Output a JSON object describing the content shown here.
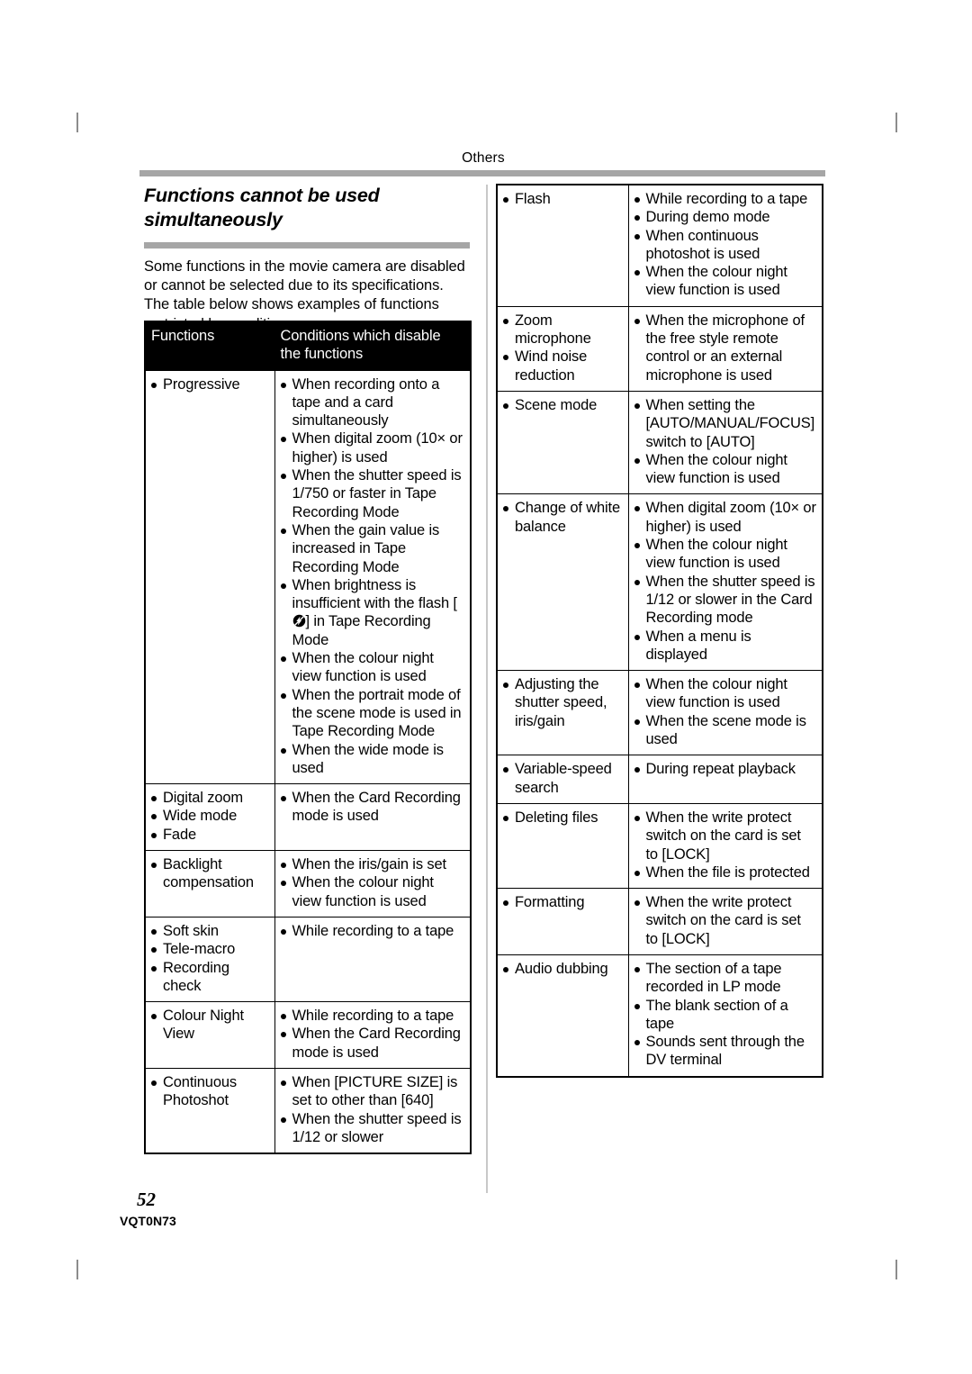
{
  "running_head": "Others",
  "page": {
    "title": "Functions cannot be used simultaneously",
    "intro": "Some functions in the movie camera are disabled or cannot be selected due to its specifications. The table below shows examples of functions restricted by conditions.",
    "folio": "52",
    "doc_code": "VQT0N73"
  },
  "table": {
    "headers": {
      "functions": "Functions",
      "conditions": "Conditions which disable the functions"
    },
    "left_rows": [
      {
        "functions": [
          "Progressive"
        ],
        "conditions": [
          "When recording onto a tape and a card simultaneously",
          "When digital zoom (10× or higher) is used",
          "When the shutter speed is 1/750 or faster in Tape Recording Mode",
          "When the gain value is increased in Tape Recording Mode",
          "When brightness is insufficient with the flash [FLASH_ICON] in Tape Recording Mode",
          "When the colour night view function is used",
          "When the portrait mode of the scene mode is used in Tape Recording Mode",
          "When the wide mode is used"
        ]
      },
      {
        "functions": [
          "Digital zoom",
          "Wide mode",
          "Fade"
        ],
        "conditions": [
          "When the Card Recording mode is used"
        ]
      },
      {
        "functions": [
          "Backlight compensation"
        ],
        "conditions": [
          "When the iris/gain is set",
          "When the colour night view function is used"
        ]
      },
      {
        "functions": [
          "Soft skin",
          "Tele-macro",
          "Recording check"
        ],
        "conditions": [
          "While recording to a tape"
        ]
      },
      {
        "functions": [
          "Colour Night View"
        ],
        "conditions": [
          "While recording to a tape",
          "When the Card Recording mode is used"
        ]
      },
      {
        "functions": [
          "Continuous Photoshot"
        ],
        "conditions": [
          "When [PICTURE SIZE] is set to other than [640]",
          "When the shutter speed is 1/12 or slower"
        ]
      }
    ],
    "right_rows": [
      {
        "functions": [
          "Flash"
        ],
        "conditions": [
          "While recording to a tape",
          "During demo mode",
          "When continuous photoshot is used",
          "When the colour night view function is used"
        ]
      },
      {
        "functions": [
          "Zoom microphone",
          "Wind noise reduction"
        ],
        "conditions": [
          "When the microphone of the free style remote control or an external microphone is used"
        ]
      },
      {
        "functions": [
          "Scene mode"
        ],
        "conditions": [
          "When setting the [AUTO/MANUAL/FOCUS] switch to [AUTO]",
          "When the colour night view function is used"
        ]
      },
      {
        "functions": [
          "Change of white balance"
        ],
        "conditions": [
          "When digital zoom (10× or higher) is used",
          "When the colour night view function is used",
          "When the shutter speed is 1/12 or slower in the Card Recording mode",
          "When a menu is displayed"
        ]
      },
      {
        "functions": [
          "Adjusting the shutter speed, iris/gain"
        ],
        "conditions": [
          "When the colour night view function is used",
          "When the scene mode is used"
        ]
      },
      {
        "functions": [
          "Variable-speed search"
        ],
        "conditions": [
          "During repeat playback"
        ]
      },
      {
        "functions": [
          "Deleting files"
        ],
        "conditions": [
          "When the write protect switch on the card is set to [LOCK]",
          "When the file is protected"
        ]
      },
      {
        "functions": [
          "Formatting"
        ],
        "conditions": [
          "When the write protect switch on the card is set to [LOCK]"
        ]
      },
      {
        "functions": [
          "Audio dubbing"
        ],
        "conditions": [
          "The section of a tape recorded in LP mode",
          "The blank section of a tape",
          "Sounds sent through the DV terminal"
        ]
      }
    ]
  },
  "icons": {
    "flash_off": "flash-off-icon"
  },
  "colors": {
    "rule_gray": "#a6a6a6",
    "divider_gray": "#c8c8c8",
    "header_bg": "#000000",
    "header_text": "#ffffff",
    "body_text": "#000000"
  }
}
